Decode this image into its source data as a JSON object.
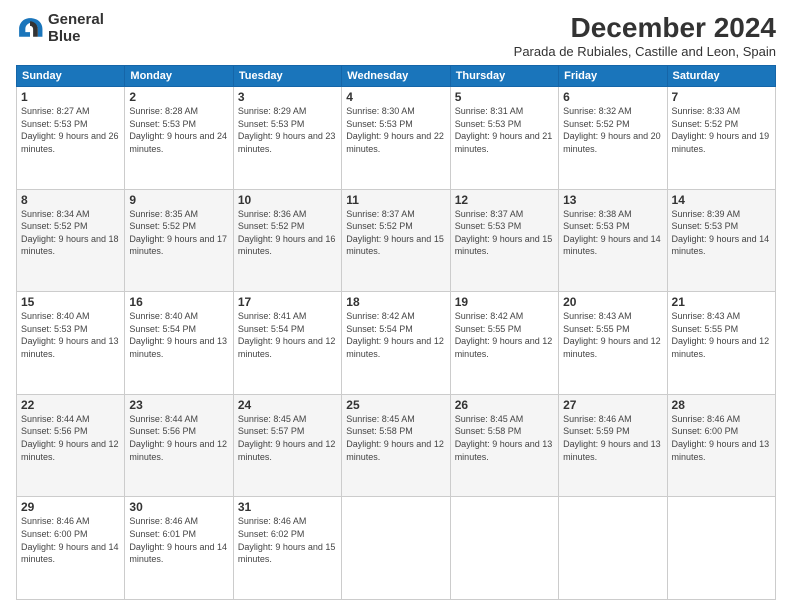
{
  "logo": {
    "line1": "General",
    "line2": "Blue"
  },
  "title": "December 2024",
  "subtitle": "Parada de Rubiales, Castille and Leon, Spain",
  "headers": [
    "Sunday",
    "Monday",
    "Tuesday",
    "Wednesday",
    "Thursday",
    "Friday",
    "Saturday"
  ],
  "weeks": [
    [
      {
        "day": "1",
        "sunrise": "Sunrise: 8:27 AM",
        "sunset": "Sunset: 5:53 PM",
        "daylight": "Daylight: 9 hours and 26 minutes."
      },
      {
        "day": "2",
        "sunrise": "Sunrise: 8:28 AM",
        "sunset": "Sunset: 5:53 PM",
        "daylight": "Daylight: 9 hours and 24 minutes."
      },
      {
        "day": "3",
        "sunrise": "Sunrise: 8:29 AM",
        "sunset": "Sunset: 5:53 PM",
        "daylight": "Daylight: 9 hours and 23 minutes."
      },
      {
        "day": "4",
        "sunrise": "Sunrise: 8:30 AM",
        "sunset": "Sunset: 5:53 PM",
        "daylight": "Daylight: 9 hours and 22 minutes."
      },
      {
        "day": "5",
        "sunrise": "Sunrise: 8:31 AM",
        "sunset": "Sunset: 5:53 PM",
        "daylight": "Daylight: 9 hours and 21 minutes."
      },
      {
        "day": "6",
        "sunrise": "Sunrise: 8:32 AM",
        "sunset": "Sunset: 5:52 PM",
        "daylight": "Daylight: 9 hours and 20 minutes."
      },
      {
        "day": "7",
        "sunrise": "Sunrise: 8:33 AM",
        "sunset": "Sunset: 5:52 PM",
        "daylight": "Daylight: 9 hours and 19 minutes."
      }
    ],
    [
      {
        "day": "8",
        "sunrise": "Sunrise: 8:34 AM",
        "sunset": "Sunset: 5:52 PM",
        "daylight": "Daylight: 9 hours and 18 minutes."
      },
      {
        "day": "9",
        "sunrise": "Sunrise: 8:35 AM",
        "sunset": "Sunset: 5:52 PM",
        "daylight": "Daylight: 9 hours and 17 minutes."
      },
      {
        "day": "10",
        "sunrise": "Sunrise: 8:36 AM",
        "sunset": "Sunset: 5:52 PM",
        "daylight": "Daylight: 9 hours and 16 minutes."
      },
      {
        "day": "11",
        "sunrise": "Sunrise: 8:37 AM",
        "sunset": "Sunset: 5:52 PM",
        "daylight": "Daylight: 9 hours and 15 minutes."
      },
      {
        "day": "12",
        "sunrise": "Sunrise: 8:37 AM",
        "sunset": "Sunset: 5:53 PM",
        "daylight": "Daylight: 9 hours and 15 minutes."
      },
      {
        "day": "13",
        "sunrise": "Sunrise: 8:38 AM",
        "sunset": "Sunset: 5:53 PM",
        "daylight": "Daylight: 9 hours and 14 minutes."
      },
      {
        "day": "14",
        "sunrise": "Sunrise: 8:39 AM",
        "sunset": "Sunset: 5:53 PM",
        "daylight": "Daylight: 9 hours and 14 minutes."
      }
    ],
    [
      {
        "day": "15",
        "sunrise": "Sunrise: 8:40 AM",
        "sunset": "Sunset: 5:53 PM",
        "daylight": "Daylight: 9 hours and 13 minutes."
      },
      {
        "day": "16",
        "sunrise": "Sunrise: 8:40 AM",
        "sunset": "Sunset: 5:54 PM",
        "daylight": "Daylight: 9 hours and 13 minutes."
      },
      {
        "day": "17",
        "sunrise": "Sunrise: 8:41 AM",
        "sunset": "Sunset: 5:54 PM",
        "daylight": "Daylight: 9 hours and 12 minutes."
      },
      {
        "day": "18",
        "sunrise": "Sunrise: 8:42 AM",
        "sunset": "Sunset: 5:54 PM",
        "daylight": "Daylight: 9 hours and 12 minutes."
      },
      {
        "day": "19",
        "sunrise": "Sunrise: 8:42 AM",
        "sunset": "Sunset: 5:55 PM",
        "daylight": "Daylight: 9 hours and 12 minutes."
      },
      {
        "day": "20",
        "sunrise": "Sunrise: 8:43 AM",
        "sunset": "Sunset: 5:55 PM",
        "daylight": "Daylight: 9 hours and 12 minutes."
      },
      {
        "day": "21",
        "sunrise": "Sunrise: 8:43 AM",
        "sunset": "Sunset: 5:55 PM",
        "daylight": "Daylight: 9 hours and 12 minutes."
      }
    ],
    [
      {
        "day": "22",
        "sunrise": "Sunrise: 8:44 AM",
        "sunset": "Sunset: 5:56 PM",
        "daylight": "Daylight: 9 hours and 12 minutes."
      },
      {
        "day": "23",
        "sunrise": "Sunrise: 8:44 AM",
        "sunset": "Sunset: 5:56 PM",
        "daylight": "Daylight: 9 hours and 12 minutes."
      },
      {
        "day": "24",
        "sunrise": "Sunrise: 8:45 AM",
        "sunset": "Sunset: 5:57 PM",
        "daylight": "Daylight: 9 hours and 12 minutes."
      },
      {
        "day": "25",
        "sunrise": "Sunrise: 8:45 AM",
        "sunset": "Sunset: 5:58 PM",
        "daylight": "Daylight: 9 hours and 12 minutes."
      },
      {
        "day": "26",
        "sunrise": "Sunrise: 8:45 AM",
        "sunset": "Sunset: 5:58 PM",
        "daylight": "Daylight: 9 hours and 13 minutes."
      },
      {
        "day": "27",
        "sunrise": "Sunrise: 8:46 AM",
        "sunset": "Sunset: 5:59 PM",
        "daylight": "Daylight: 9 hours and 13 minutes."
      },
      {
        "day": "28",
        "sunrise": "Sunrise: 8:46 AM",
        "sunset": "Sunset: 6:00 PM",
        "daylight": "Daylight: 9 hours and 13 minutes."
      }
    ],
    [
      {
        "day": "29",
        "sunrise": "Sunrise: 8:46 AM",
        "sunset": "Sunset: 6:00 PM",
        "daylight": "Daylight: 9 hours and 14 minutes."
      },
      {
        "day": "30",
        "sunrise": "Sunrise: 8:46 AM",
        "sunset": "Sunset: 6:01 PM",
        "daylight": "Daylight: 9 hours and 14 minutes."
      },
      {
        "day": "31",
        "sunrise": "Sunrise: 8:46 AM",
        "sunset": "Sunset: 6:02 PM",
        "daylight": "Daylight: 9 hours and 15 minutes."
      },
      null,
      null,
      null,
      null
    ]
  ]
}
